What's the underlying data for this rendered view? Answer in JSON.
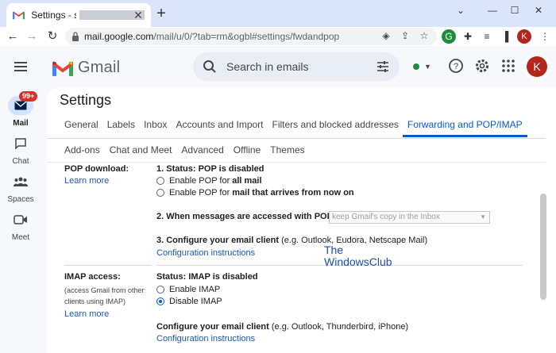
{
  "browser": {
    "tab_title": "Settings - s",
    "new_tab": "+",
    "url_host": "mail.google.com",
    "url_path": "/mail/u/0/?tab=rm&ogbl#settings/fwdandpop",
    "window_controls": [
      "minimize",
      "maximize",
      "close"
    ]
  },
  "header": {
    "app_name": "Gmail",
    "search_placeholder": "Search in emails",
    "avatar_letter": "K",
    "status_color": "#1e8e3e"
  },
  "rail": {
    "items": [
      {
        "label": "Mail",
        "icon": "mail-icon",
        "badge": "99+",
        "active": true
      },
      {
        "label": "Chat",
        "icon": "chat-icon"
      },
      {
        "label": "Spaces",
        "icon": "spaces-icon"
      },
      {
        "label": "Meet",
        "icon": "meet-icon"
      }
    ]
  },
  "settings": {
    "title": "Settings",
    "tabs_row1": [
      "General",
      "Labels",
      "Inbox",
      "Accounts and Import",
      "Filters and blocked addresses",
      "Forwarding and POP/IMAP"
    ],
    "tabs_row2": [
      "Add-ons",
      "Chat and Meet",
      "Advanced",
      "Offline",
      "Themes"
    ],
    "active_tab": "Forwarding and POP/IMAP",
    "pop": {
      "label": "POP download:",
      "learn_more": "Learn more",
      "status_prefix": "1. Status: ",
      "status": "POP is disabled",
      "option1_prefix": "Enable POP for ",
      "option1_bold": "all mail",
      "option2_prefix": "Enable POP for ",
      "option2_bold": "mail that arrives from now on",
      "step2": "2. When messages are accessed with POP",
      "step2_select": "keep Gmail's copy in the Inbox",
      "step3_bold": "3. Configure your email client",
      "step3_rest": " (e.g. Outlook, Eudora, Netscape Mail)",
      "config_link": "Configuration instructions"
    },
    "imap": {
      "label": "IMAP access:",
      "sub": "(access Gmail from other clients using IMAP)",
      "learn_more": "Learn more",
      "status": "Status: IMAP is disabled",
      "option_enable": "Enable IMAP",
      "option_disable": "Disable IMAP",
      "selected": "Disable IMAP",
      "configure_bold": "Configure your email client",
      "configure_rest": " (e.g. Outlook, Thunderbird, iPhone)",
      "config_link": "Configuration instructions"
    }
  },
  "watermark": {
    "line1": "The",
    "line2": "WindowsClub"
  },
  "colors": {
    "accent": "#0b57d0",
    "link": "#1a57b3",
    "badge": "#d93025",
    "avatar": "#b3261e"
  }
}
